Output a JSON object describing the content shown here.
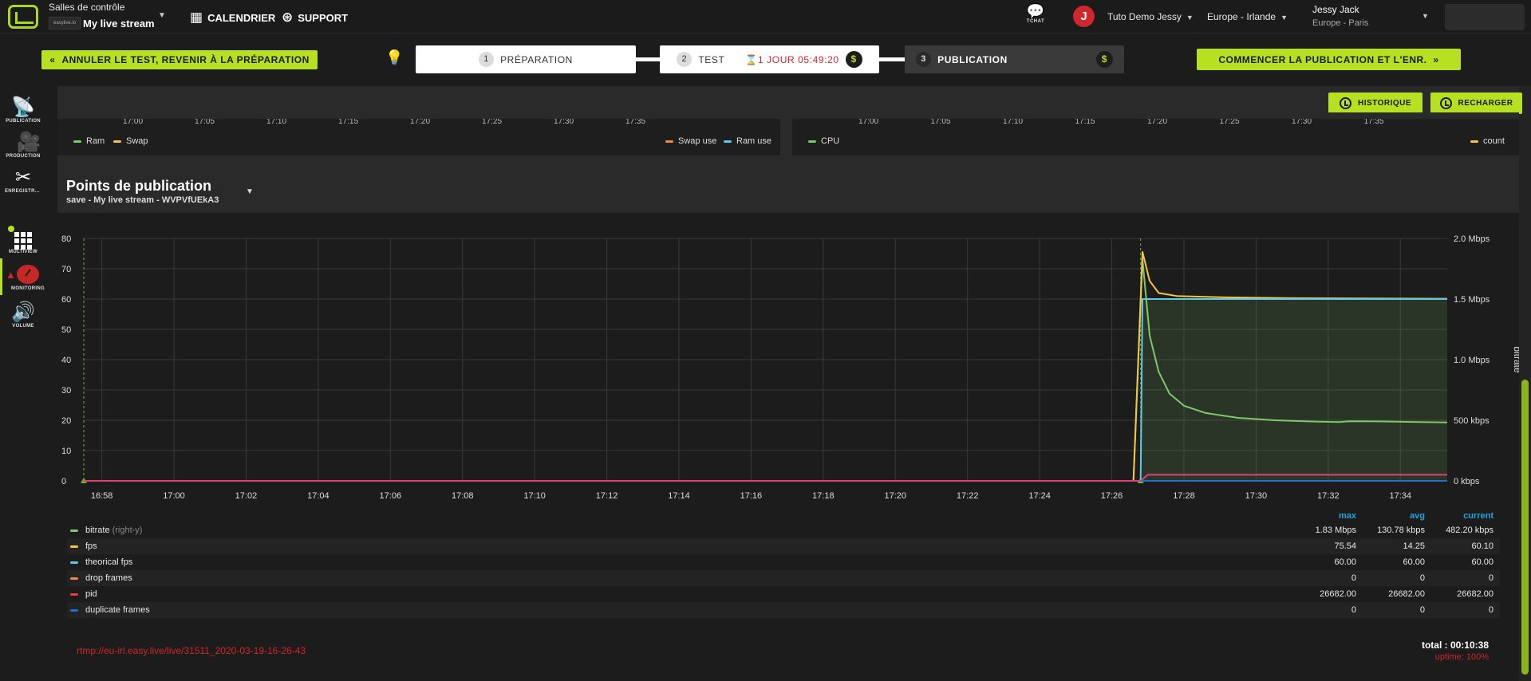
{
  "header": {
    "room_title": "Salles de contrôle",
    "room_brand": "easylive.io",
    "room_name": "My live stream",
    "nav": [
      {
        "label": "CALENDRIER",
        "icon": "calendar-icon"
      },
      {
        "label": "SUPPORT",
        "icon": "lifebuoy-icon"
      }
    ],
    "chat_label": "TCHAT",
    "avatar_letter": "J",
    "org": "Tuto Demo Jessy",
    "region": "Europe - Irlande",
    "user_name": "Jessy Jack",
    "user_tz": "Europe - Paris"
  },
  "steps": {
    "cancel_label": "ANNULER LE TEST, REVENIR À LA PRÉPARATION",
    "start_label": "COMMENCER LA PUBLICATION ET L'ENR.",
    "items": [
      {
        "num": "1",
        "label": "PRÉPARATION"
      },
      {
        "num": "2",
        "label": "TEST",
        "timer": "1 JOUR 05:49:20"
      },
      {
        "num": "3",
        "label": "PUBLICATION"
      }
    ],
    "dollar": "$"
  },
  "sidebar": {
    "items": [
      {
        "label": "PUBLICATION",
        "icon": "satellite-dish-icon"
      },
      {
        "label": "PRODUCTION",
        "icon": "video-camera-icon"
      },
      {
        "label": "ENREGISTR...",
        "icon": "scissors-icon"
      },
      {
        "label": "MULTIVIEW",
        "icon": "grid-icon"
      },
      {
        "label": "MONITORING",
        "icon": "gauge-icon"
      },
      {
        "label": "VOLUME",
        "icon": "speaker-icon"
      }
    ]
  },
  "toolbar": {
    "history_label": "HISTORIQUE",
    "reload_label": "RECHARGER"
  },
  "mini_charts": {
    "ticks": [
      "17:00",
      "17:05",
      "17:10",
      "17:15",
      "17:20",
      "17:25",
      "17:30",
      "17:35"
    ],
    "left_legend": [
      {
        "label": "Ram",
        "color": "#7ec96b"
      },
      {
        "label": "Swap",
        "color": "#f4c542"
      },
      {
        "label": "Swap use",
        "color": "#f08a3c"
      },
      {
        "label": "Ram use",
        "color": "#5ec8e8"
      }
    ],
    "right_legend": [
      {
        "label": "CPU",
        "color": "#7ec96b"
      },
      {
        "label": "count",
        "color": "#f4c542"
      }
    ]
  },
  "publication": {
    "title": "Points de publication",
    "subtitle": "save - My live stream - WVPVfUEkA3",
    "rtmp": "rtmp://eu-irl.easy.live/live/31511_2020-03-19-16-26-43",
    "total": "total : 00:10:38",
    "uptime": "uptime: 100%"
  },
  "chart_data": {
    "type": "line",
    "x_ticks": [
      "16:58",
      "17:00",
      "17:02",
      "17:04",
      "17:06",
      "17:08",
      "17:10",
      "17:12",
      "17:14",
      "17:16",
      "17:18",
      "17:20",
      "17:22",
      "17:24",
      "17:26",
      "17:28",
      "17:30",
      "17:32",
      "17:34"
    ],
    "x_range_minutes": [
      1017.5,
      1055.3
    ],
    "ylim": [
      0,
      80
    ],
    "y_ticks": [
      0,
      10,
      20,
      30,
      40,
      50,
      60,
      70,
      80
    ],
    "y2_ticks": [
      "0 kbps",
      "500 kbps",
      "1.0 Mbps",
      "1.5 Mbps",
      "2.0 Mbps"
    ],
    "y2lim_kbps": [
      0,
      2000
    ],
    "y2_label": "bitrate",
    "grid": true,
    "series": [
      {
        "name": "bitrate",
        "axis": "right",
        "color": "#7ec96b",
        "points": [
          [
            1017.5,
            0
          ],
          [
            1046.6,
            0
          ],
          [
            1046.85,
            1830
          ],
          [
            1047.05,
            1200
          ],
          [
            1047.3,
            900
          ],
          [
            1047.6,
            720
          ],
          [
            1048.0,
            620
          ],
          [
            1048.6,
            560
          ],
          [
            1049.5,
            520
          ],
          [
            1050.5,
            500
          ],
          [
            1051.5,
            490
          ],
          [
            1052.3,
            485
          ],
          [
            1052.6,
            492
          ],
          [
            1053.5,
            490
          ],
          [
            1054.5,
            485
          ],
          [
            1055.3,
            482.2
          ]
        ]
      },
      {
        "name": "fps",
        "axis": "left",
        "color": "#f4c542",
        "points": [
          [
            1017.5,
            0
          ],
          [
            1046.6,
            0
          ],
          [
            1046.85,
            75.54
          ],
          [
            1047.05,
            66
          ],
          [
            1047.3,
            62
          ],
          [
            1047.8,
            61
          ],
          [
            1049,
            60.6
          ],
          [
            1051,
            60.3
          ],
          [
            1053,
            60.2
          ],
          [
            1055.3,
            60.1
          ]
        ]
      },
      {
        "name": "theorical fps",
        "axis": "left",
        "color": "#5ec8e8",
        "points": [
          [
            1046.8,
            0
          ],
          [
            1046.85,
            60
          ],
          [
            1055.3,
            60
          ]
        ]
      },
      {
        "name": "drop frames",
        "axis": "left",
        "color": "#f08a3c",
        "points": [
          [
            1017.5,
            0
          ],
          [
            1055.3,
            0
          ]
        ]
      },
      {
        "name": "pid",
        "axis": "left",
        "color": "#e0407a",
        "points": [
          [
            1017.5,
            0
          ],
          [
            1046.8,
            0
          ],
          [
            1047.0,
            2
          ],
          [
            1055.3,
            2
          ]
        ]
      },
      {
        "name": "duplicate frames",
        "axis": "left",
        "color": "#1f6fd0",
        "points": [
          [
            1046.8,
            0
          ],
          [
            1055.3,
            0
          ]
        ]
      }
    ],
    "stats_headers": [
      "max",
      "avg",
      "current"
    ],
    "stats": [
      {
        "name": "bitrate",
        "hint": "(right-y)",
        "color": "#7ec96b",
        "max": "1.83 Mbps",
        "avg": "130.78 kbps",
        "current": "482.20 kbps"
      },
      {
        "name": "fps",
        "hint": "",
        "color": "#f4c542",
        "max": "75.54",
        "avg": "14.25",
        "current": "60.10"
      },
      {
        "name": "theorical fps",
        "hint": "",
        "color": "#5ec8e8",
        "max": "60.00",
        "avg": "60.00",
        "current": "60.00"
      },
      {
        "name": "drop frames",
        "hint": "",
        "color": "#f08a3c",
        "max": "0",
        "avg": "0",
        "current": "0"
      },
      {
        "name": "pid",
        "hint": "",
        "color": "#e04040",
        "max": "26682.00",
        "avg": "26682.00",
        "current": "26682.00"
      },
      {
        "name": "duplicate frames",
        "hint": "",
        "color": "#1f6fd0",
        "max": "0",
        "avg": "0",
        "current": "0"
      }
    ]
  }
}
